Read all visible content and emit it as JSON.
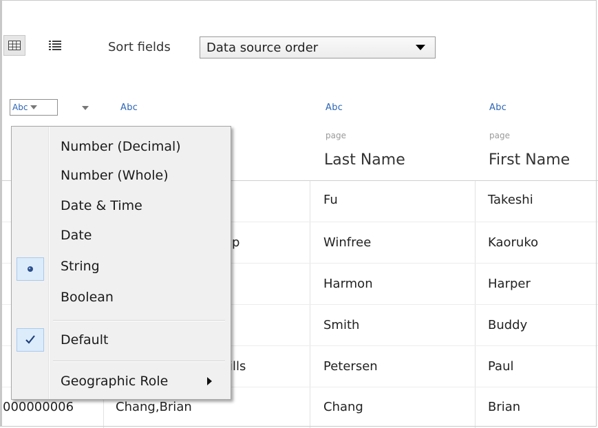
{
  "toolbar": {
    "sort_label": "Sort fields",
    "sort_value": "Data source order"
  },
  "columns": [
    {
      "type": "Abc",
      "role": "",
      "name": ""
    },
    {
      "type": "Abc",
      "role": "",
      "name": ""
    },
    {
      "type": "Abc",
      "role": "page",
      "name": "Last Name"
    },
    {
      "type": "Abc",
      "role": "page",
      "name": "First Name"
    }
  ],
  "rows": [
    {
      "c2": "Fu",
      "c3": "Takeshi"
    },
    {
      "c1_frag": "p",
      "c2": "Winfree",
      "c3": "Kaoruko"
    },
    {
      "c2": "Harmon",
      "c3": "Harper"
    },
    {
      "c2": "Smith",
      "c3": "Buddy"
    },
    {
      "c1_frag": "ills",
      "c2": "Petersen",
      "c3": "Paul"
    },
    {
      "c0": "000000006",
      "c1": "Chang,Brian",
      "c2": "Chang",
      "c3": "Brian"
    }
  ],
  "menu": {
    "items": [
      "Number (Decimal)",
      "Number (Whole)",
      "Date & Time",
      "Date",
      "String",
      "Boolean"
    ],
    "selected": "String",
    "default_label": "Default",
    "geo_label": "Geographic Role"
  },
  "icons": {
    "grid_view": "grid-view-icon",
    "list_view": "list-view-icon",
    "radio": "radio-dot-icon",
    "check": "checkmark-icon"
  },
  "colors": {
    "accent": "#2a63b5",
    "menu_bg": "#f0f0f0",
    "selection": "#dcecfb"
  }
}
